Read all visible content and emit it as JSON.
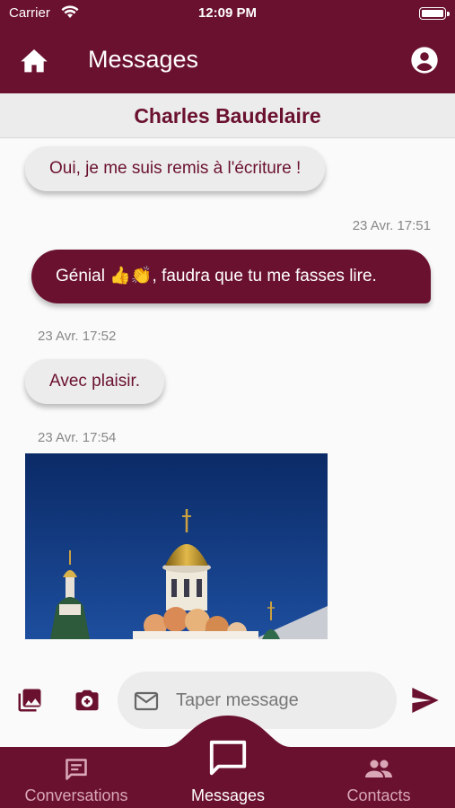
{
  "status": {
    "carrier": "Carrier",
    "time": "12:09 PM"
  },
  "appbar": {
    "title": "Messages",
    "home_icon": "home-icon",
    "account_icon": "account-circle-icon"
  },
  "contact": {
    "name": "Charles Baudelaire"
  },
  "messages": [
    {
      "direction": "incoming",
      "text": "Oui, je me suis remis à  l'écriture   !"
    },
    {
      "timestamp": "23 Avr. 17:51"
    },
    {
      "direction": "outgoing",
      "text": "Génial 👍👏, faudra que tu me fasses lire."
    },
    {
      "timestamp": "23 Avr. 17:52"
    },
    {
      "direction": "incoming",
      "text": "Avec plaisir."
    },
    {
      "timestamp": "23 Avr. 17:54"
    },
    {
      "direction": "incoming",
      "type": "image"
    }
  ],
  "composer": {
    "placeholder": "Taper message"
  },
  "nav": {
    "items": [
      {
        "label": "Conversations",
        "icon": "chat-bubble-icon",
        "active": false
      },
      {
        "label": "Messages",
        "icon": "message-icon",
        "active": true
      },
      {
        "label": "Contacts",
        "icon": "people-icon",
        "active": false
      }
    ]
  },
  "colors": {
    "brand": "#6b1130",
    "bubble_in": "#ececec",
    "background": "#fafafa"
  }
}
